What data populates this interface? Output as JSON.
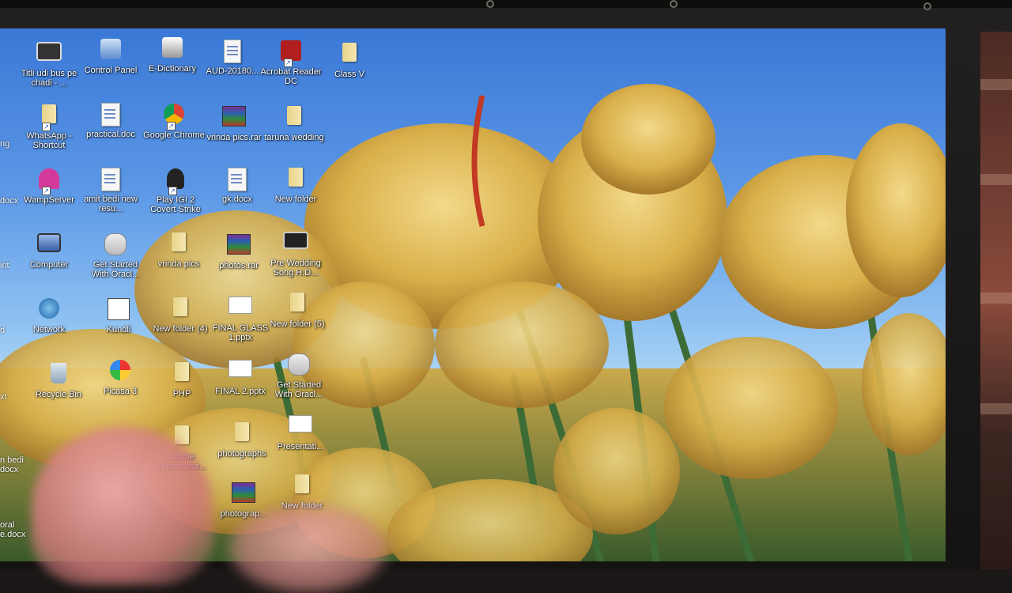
{
  "desktop": {
    "icons": [
      {
        "label": "Titli udi bus pe chadi - ...",
        "kind": "video"
      },
      {
        "label": "Control Panel",
        "kind": "control-panel"
      },
      {
        "label": "E-Dictionary",
        "kind": "app"
      },
      {
        "label": "AUD-20180...",
        "kind": "audio"
      },
      {
        "label": "Acrobat Reader DC",
        "kind": "acrobat"
      },
      {
        "label": "Class V",
        "kind": "folder"
      },
      {
        "label": "WhatsApp - Shortcut",
        "kind": "folder"
      },
      {
        "label": "practical.doc",
        "kind": "doc"
      },
      {
        "label": "Google Chrome",
        "kind": "chrome"
      },
      {
        "label": "vrinda pics.rar",
        "kind": "rar"
      },
      {
        "label": "taruna wedding",
        "kind": "folder"
      },
      {
        "label": "WampServer",
        "kind": "wamp"
      },
      {
        "label": "amit bedi new resu...",
        "kind": "doc"
      },
      {
        "label": "Play IGI 2 Covert Strike",
        "kind": "game"
      },
      {
        "label": "gk.docx",
        "kind": "doc"
      },
      {
        "label": "New folder",
        "kind": "folder"
      },
      {
        "label": "Computer",
        "kind": "computer"
      },
      {
        "label": "Get Started With Oracl...",
        "kind": "oracle"
      },
      {
        "label": "vrinda pics",
        "kind": "folder"
      },
      {
        "label": "photos.rar",
        "kind": "rar"
      },
      {
        "label": "Pre Wedding Song H.D...",
        "kind": "video"
      },
      {
        "label": "Network",
        "kind": "network"
      },
      {
        "label": "Kundli",
        "kind": "kundli"
      },
      {
        "label": "New folder (4)",
        "kind": "folder"
      },
      {
        "label": "FINAL GLASS 1.pptx",
        "kind": "ppt"
      },
      {
        "label": "New folder (5)",
        "kind": "folder"
      },
      {
        "label": "Recycle Bin",
        "kind": "recycle"
      },
      {
        "label": "Picasa 3",
        "kind": "picasa"
      },
      {
        "label": "PHP",
        "kind": "folder"
      },
      {
        "label": "FINAL 2.pptx",
        "kind": "ppt"
      },
      {
        "label": "Get Started With Oracl...",
        "kind": "oracle"
      },
      {
        "label": "Adobe Dreamwea...",
        "kind": "folder"
      },
      {
        "label": "photographs",
        "kind": "folder"
      },
      {
        "label": "Presentati...",
        "kind": "ppt"
      },
      {
        "label": "photograp...",
        "kind": "rar"
      },
      {
        "label": "New folder",
        "kind": "folder"
      }
    ],
    "edge_labels": [
      "ng",
      "docx",
      "int",
      "d",
      "xt",
      "n bedi docx",
      "oral e.docx"
    ]
  },
  "colors": {
    "sky": "#4b8ee0",
    "tulip": "#e8c35a",
    "stem": "#3d6b35",
    "accent_red": "#c23a24"
  }
}
